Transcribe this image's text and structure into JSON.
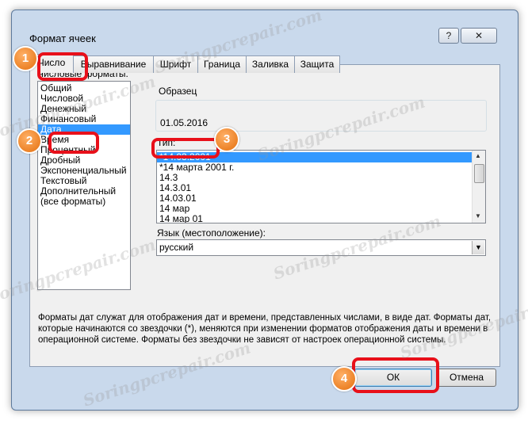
{
  "window": {
    "title": "Формат ячеек",
    "help_symbol": "?",
    "close_symbol": "✕"
  },
  "tabs": [
    {
      "label": "Число",
      "active": true
    },
    {
      "label": "Выравнивание",
      "active": false
    },
    {
      "label": "Шрифт",
      "active": false
    },
    {
      "label": "Граница",
      "active": false
    },
    {
      "label": "Заливка",
      "active": false
    },
    {
      "label": "Защита",
      "active": false
    }
  ],
  "number_formats": {
    "label": "Числовые форматы:",
    "items": [
      "Общий",
      "Числовой",
      "Денежный",
      "Финансовый",
      "Дата",
      "Время",
      "Процентный",
      "Дробный",
      "Экспоненциальный",
      "Текстовый",
      "Дополнительный",
      "(все форматы)"
    ],
    "selected": "Дата"
  },
  "sample": {
    "label": "Образец",
    "value": "01.05.2016"
  },
  "type": {
    "label": "Тип:",
    "items": [
      "*14.03.2001",
      "*14 марта 2001 г.",
      "14.3",
      "14.3.01",
      "14.03.01",
      "14 мар",
      "14 мар 01"
    ],
    "selected": "*14.03.2001"
  },
  "language": {
    "label": "Язык (местоположение):",
    "value": "русский"
  },
  "description": "Форматы дат служат для отображения дат и времени, представленных числами, в виде дат. Форматы дат, которые начинаются со звездочки (*), меняются при изменении форматов отображения даты и времени в операционной системе. Форматы без звездочки не зависят от настроек операционной системы.",
  "buttons": {
    "ok": "ОК",
    "cancel": "Отмена"
  },
  "markers": [
    "1",
    "2",
    "3",
    "4"
  ],
  "watermark": "Soringpcrepair.com",
  "colors": {
    "highlight": "#e8101a",
    "marker": "#f0821e",
    "selection": "#3399ff"
  }
}
